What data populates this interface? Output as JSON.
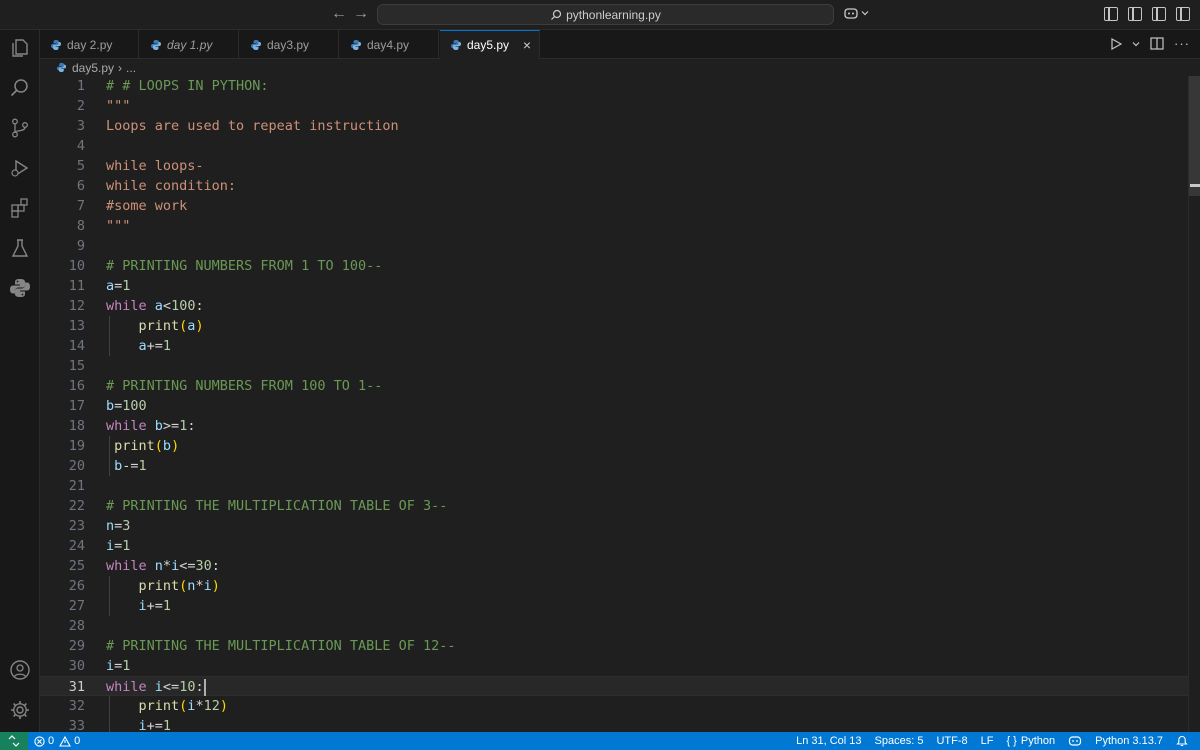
{
  "window": {
    "search_text": "pythonlearning.py"
  },
  "tabs": [
    {
      "label": "day 2.py",
      "italic": false
    },
    {
      "label": "day 1.py",
      "italic": true
    },
    {
      "label": "day3.py",
      "italic": false
    },
    {
      "label": "day4.py",
      "italic": false
    },
    {
      "label": "day5.py",
      "italic": false,
      "active": true
    }
  ],
  "breadcrumb": {
    "file": "day5.py",
    "separator": "›",
    "more": "..."
  },
  "editor": {
    "current_line": 31,
    "lines": [
      {
        "n": "1",
        "tokens": [
          [
            "# # LOOPS IN PYTHON:",
            "t-com"
          ]
        ]
      },
      {
        "n": "2",
        "tokens": [
          [
            "\"\"\"",
            "t-str"
          ]
        ]
      },
      {
        "n": "3",
        "tokens": [
          [
            "Loops are used to repeat instruction",
            "t-str"
          ]
        ]
      },
      {
        "n": "4",
        "tokens": []
      },
      {
        "n": "5",
        "tokens": [
          [
            "while loops-",
            "t-str"
          ]
        ]
      },
      {
        "n": "6",
        "tokens": [
          [
            "while condition:",
            "t-str"
          ]
        ]
      },
      {
        "n": "7",
        "tokens": [
          [
            "#some work",
            "t-str"
          ]
        ]
      },
      {
        "n": "8",
        "tokens": [
          [
            "\"\"\"",
            "t-str"
          ]
        ]
      },
      {
        "n": "9",
        "tokens": []
      },
      {
        "n": "10",
        "tokens": [
          [
            "# PRINTING NUMBERS FROM 1 TO 100--",
            "t-com"
          ]
        ]
      },
      {
        "n": "11",
        "tokens": [
          [
            "a",
            "t-var"
          ],
          [
            "=",
            "t-op"
          ],
          [
            "1",
            "t-num"
          ]
        ]
      },
      {
        "n": "12",
        "tokens": [
          [
            "while",
            "t-kw"
          ],
          [
            " ",
            "t-op"
          ],
          [
            "a",
            "t-var"
          ],
          [
            "<",
            "t-op"
          ],
          [
            "100",
            "t-num"
          ],
          [
            ":",
            "t-op"
          ]
        ]
      },
      {
        "n": "13",
        "tokens": [
          [
            "    ",
            "t-op"
          ],
          [
            "print",
            "t-fn"
          ],
          [
            "(",
            "t-br"
          ],
          [
            "a",
            "t-var"
          ],
          [
            ")",
            "t-br"
          ]
        ],
        "guide": true
      },
      {
        "n": "14",
        "tokens": [
          [
            "    ",
            "t-op"
          ],
          [
            "a",
            "t-var"
          ],
          [
            "+=",
            "t-op"
          ],
          [
            "1",
            "t-num"
          ]
        ],
        "guide": true
      },
      {
        "n": "15",
        "tokens": []
      },
      {
        "n": "16",
        "tokens": [
          [
            "# PRINTING NUMBERS FROM 100 TO 1--",
            "t-com"
          ]
        ]
      },
      {
        "n": "17",
        "tokens": [
          [
            "b",
            "t-var"
          ],
          [
            "=",
            "t-op"
          ],
          [
            "100",
            "t-num"
          ]
        ]
      },
      {
        "n": "18",
        "tokens": [
          [
            "while",
            "t-kw"
          ],
          [
            " ",
            "t-op"
          ],
          [
            "b",
            "t-var"
          ],
          [
            ">=",
            "t-op"
          ],
          [
            "1",
            "t-num"
          ],
          [
            ":",
            "t-op"
          ]
        ]
      },
      {
        "n": "19",
        "tokens": [
          [
            " ",
            "t-op"
          ],
          [
            "print",
            "t-fn"
          ],
          [
            "(",
            "t-br"
          ],
          [
            "b",
            "t-var"
          ],
          [
            ")",
            "t-br"
          ]
        ],
        "guide": true
      },
      {
        "n": "20",
        "tokens": [
          [
            " ",
            "t-op"
          ],
          [
            "b",
            "t-var"
          ],
          [
            "-=",
            "t-op"
          ],
          [
            "1",
            "t-num"
          ]
        ],
        "guide": true
      },
      {
        "n": "21",
        "tokens": []
      },
      {
        "n": "22",
        "tokens": [
          [
            "# PRINTING THE MULTIPLICATION TABLE OF 3--",
            "t-com"
          ]
        ]
      },
      {
        "n": "23",
        "tokens": [
          [
            "n",
            "t-var"
          ],
          [
            "=",
            "t-op"
          ],
          [
            "3",
            "t-num"
          ]
        ]
      },
      {
        "n": "24",
        "tokens": [
          [
            "i",
            "t-var"
          ],
          [
            "=",
            "t-op"
          ],
          [
            "1",
            "t-num"
          ]
        ]
      },
      {
        "n": "25",
        "tokens": [
          [
            "while",
            "t-kw"
          ],
          [
            " ",
            "t-op"
          ],
          [
            "n",
            "t-var"
          ],
          [
            "*",
            "t-op"
          ],
          [
            "i",
            "t-var"
          ],
          [
            "<=",
            "t-op"
          ],
          [
            "30",
            "t-num"
          ],
          [
            ":",
            "t-op"
          ]
        ]
      },
      {
        "n": "26",
        "tokens": [
          [
            "    ",
            "t-op"
          ],
          [
            "print",
            "t-fn"
          ],
          [
            "(",
            "t-br"
          ],
          [
            "n",
            "t-var"
          ],
          [
            "*",
            "t-op"
          ],
          [
            "i",
            "t-var"
          ],
          [
            ")",
            "t-br"
          ]
        ],
        "guide": true
      },
      {
        "n": "27",
        "tokens": [
          [
            "    ",
            "t-op"
          ],
          [
            "i",
            "t-var"
          ],
          [
            "+=",
            "t-op"
          ],
          [
            "1",
            "t-num"
          ]
        ],
        "guide": true
      },
      {
        "n": "28",
        "tokens": []
      },
      {
        "n": "29",
        "tokens": [
          [
            "# PRINTING THE MULTIPLICATION TABLE OF 12--",
            "t-com"
          ]
        ]
      },
      {
        "n": "30",
        "tokens": [
          [
            "i",
            "t-var"
          ],
          [
            "=",
            "t-op"
          ],
          [
            "1",
            "t-num"
          ]
        ]
      },
      {
        "n": "31",
        "tokens": [
          [
            "while",
            "t-kw"
          ],
          [
            " ",
            "t-op"
          ],
          [
            "i",
            "t-var"
          ],
          [
            "<=",
            "t-op"
          ],
          [
            "10",
            "t-num"
          ],
          [
            ":",
            "t-op"
          ]
        ],
        "cursor": true
      },
      {
        "n": "32",
        "tokens": [
          [
            "    ",
            "t-op"
          ],
          [
            "print",
            "t-fn"
          ],
          [
            "(",
            "t-br"
          ],
          [
            "i",
            "t-var"
          ],
          [
            "*",
            "t-op"
          ],
          [
            "12",
            "t-num"
          ],
          [
            ")",
            "t-br"
          ]
        ],
        "guide": true
      },
      {
        "n": "33",
        "tokens": [
          [
            "    ",
            "t-op"
          ],
          [
            "i",
            "t-var"
          ],
          [
            "+=",
            "t-op"
          ],
          [
            "1",
            "t-num"
          ]
        ],
        "guide": true
      }
    ]
  },
  "statusbar": {
    "errors": "0",
    "warnings": "0",
    "position": "Ln 31, Col 13",
    "indent": "Spaces: 5",
    "encoding": "UTF-8",
    "eol": "LF",
    "language": "Python",
    "interpreter": "Python 3.13.7",
    "language_braces": "{ }"
  },
  "colors": {
    "accent": "#0078d4",
    "status_bg": "#0078d4",
    "remote_bg": "#16825d",
    "python_icon": "#3d7ab8"
  }
}
